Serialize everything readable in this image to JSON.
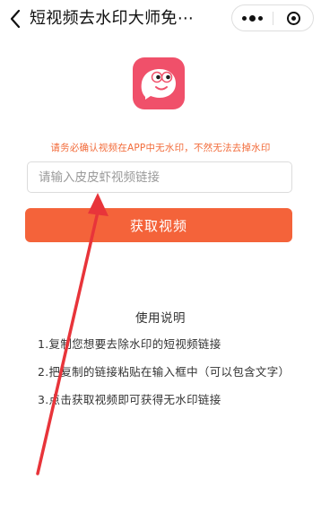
{
  "navbar": {
    "title": "短视频去水印大师免⋯",
    "back_icon": "chevron-left-icon",
    "more_icon": "more-dots-icon",
    "close_icon": "target-close-icon"
  },
  "logo": {
    "icon": "chat-bubble-face-logo",
    "color": "#f0506a"
  },
  "notice": {
    "text": "请务必确认视频在APP中无水印，不然无法去掉水印",
    "color": "#f26b3a"
  },
  "input": {
    "placeholder": "请输入皮皮虾视频链接",
    "value": ""
  },
  "button": {
    "label": "获取视频",
    "color": "#f4633a"
  },
  "instructions": {
    "title": "使用说明",
    "items": [
      "1.复制您想要去除水印的短视频链接",
      "2.把复制的链接粘贴在输入框中（可以包含文字）",
      "3.点击获取视频即可获得无水印链接"
    ]
  },
  "annotation": {
    "icon": "red-arrow-annotation",
    "color": "#e8343a"
  }
}
